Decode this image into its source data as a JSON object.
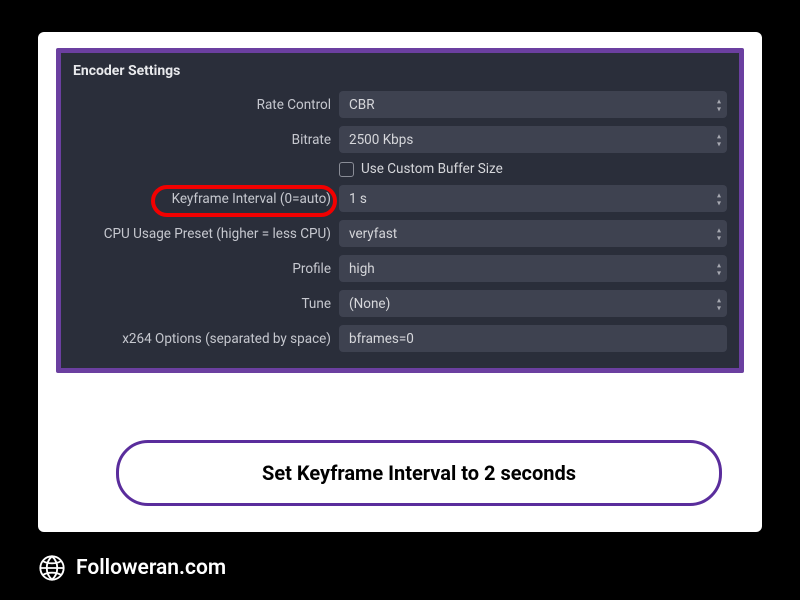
{
  "panel": {
    "title": "Encoder Settings",
    "labels": {
      "rate_control": "Rate Control",
      "bitrate": "Bitrate",
      "custom_buffer": "Use Custom Buffer Size",
      "keyframe_interval": "Keyframe Interval (0=auto)",
      "cpu_preset": "CPU Usage Preset (higher = less CPU)",
      "profile": "Profile",
      "tune": "Tune",
      "x264_options": "x264 Options (separated by space)"
    },
    "values": {
      "rate_control": "CBR",
      "bitrate": "2500 Kbps",
      "keyframe_interval": "1 s",
      "cpu_preset": "veryfast",
      "profile": "high",
      "tune": "(None)",
      "x264_options": "bframes=0"
    }
  },
  "caption": "Set Keyframe Interval to 2 seconds",
  "footer": {
    "site": "Followeran.com"
  }
}
